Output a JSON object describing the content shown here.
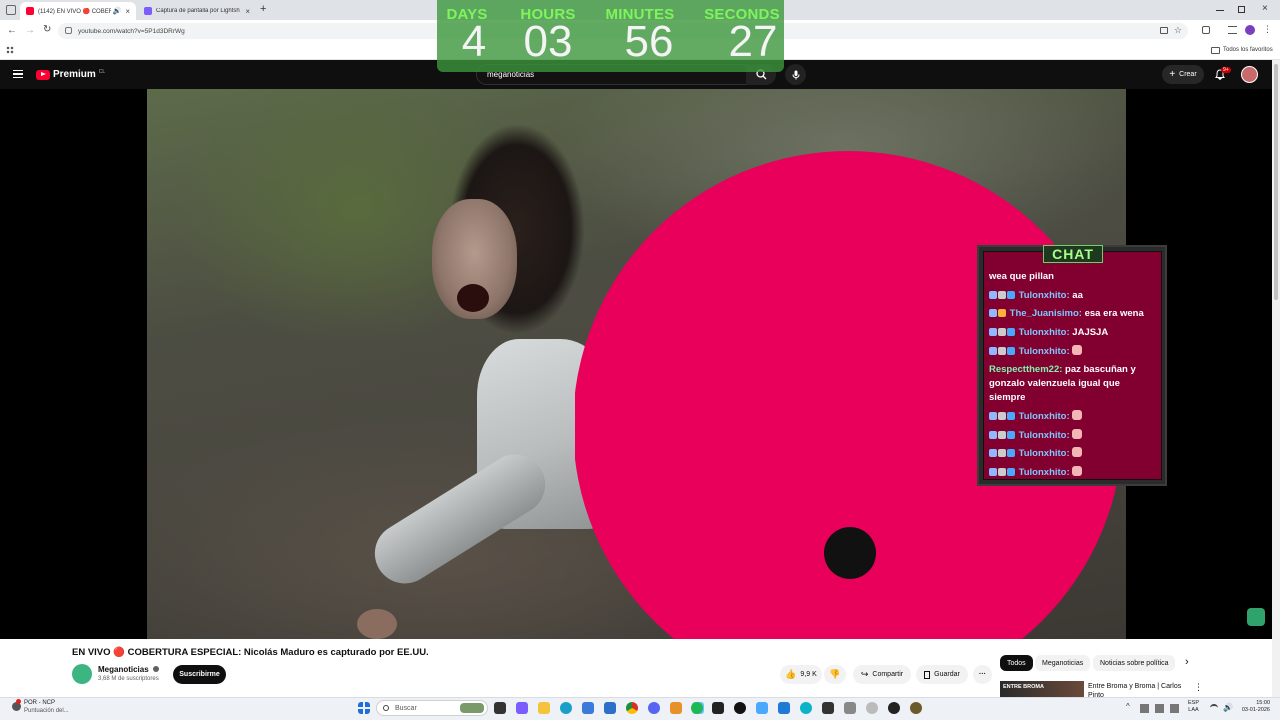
{
  "browser": {
    "tabs": [
      {
        "title": "(1142) EN VIVO 🔴 COBERT",
        "active": true
      },
      {
        "title": "Captura de pantalla por Lightsh",
        "active": false
      }
    ],
    "new_tab": "+",
    "url": "youtube.com/watch?v=5P1d3DRrWg",
    "bookmarks_label": "Todos los favoritos"
  },
  "youtube": {
    "logo_text": "Premium",
    "country_code": "CL",
    "search_value": "meganoticias",
    "create_label": "Crear",
    "notifications_count": "9+"
  },
  "countdown": {
    "days_label": "DAYS",
    "days": "4",
    "hours_label": "HOURS",
    "hours": "03",
    "minutes_label": "MINUTES",
    "minutes": "56",
    "seconds_label": "SECONDS",
    "seconds": "27"
  },
  "chat": {
    "title": "CHAT",
    "messages": [
      {
        "user": "",
        "text": "wea que pillan"
      },
      {
        "user": "Tulonxhito:",
        "text": "aa"
      },
      {
        "user": "The_Juanisimo:",
        "text": "esa era wena"
      },
      {
        "user": "Tulonxhito:",
        "text": "JAJSJA"
      },
      {
        "user": "Tulonxhito:",
        "text": ""
      },
      {
        "user": "Respectthem22:",
        "text": "paz bascuñan y gonzalo valenzuela igual que siempre"
      },
      {
        "user": "Tulonxhito:",
        "text": ""
      },
      {
        "user": "Tulonxhito:",
        "text": ""
      },
      {
        "user": "Tulonxhito:",
        "text": ""
      },
      {
        "user": "Tulonxhito:",
        "text": ""
      }
    ]
  },
  "video": {
    "title": "EN VIVO 🔴 COBERTURA ESPECIAL: Nicolás Maduro es capturado por EE.UU.",
    "channel": "Meganoticias",
    "subscribers": "3,68 M de suscriptores",
    "subscribe_label": "Suscribirme",
    "likes": "9,9 K",
    "share_label": "Compartir",
    "save_label": "Guardar",
    "more_label": "···"
  },
  "chips": [
    "Todos",
    "Meganoticias",
    "Noticias sobre política"
  ],
  "recommendation": {
    "title": "Entre Broma y Broma | Carlos Pinto",
    "thumb_text": "ENTRE BROMA"
  },
  "taskbar": {
    "search_placeholder": "Buscar",
    "weather_line1": "POR - NCP",
    "weather_line2": "Puntuación del...",
    "lang_line1": "ESP",
    "lang_line2": "LAA",
    "time": "15:00",
    "date": "03-01-2026"
  },
  "colors": {
    "overlay_circle": "#e8005a",
    "countdown_bg": "#3c963c",
    "countdown_label": "#7ef55a",
    "chat_bg": "#82002f",
    "youtube_red": "#ff0033"
  }
}
